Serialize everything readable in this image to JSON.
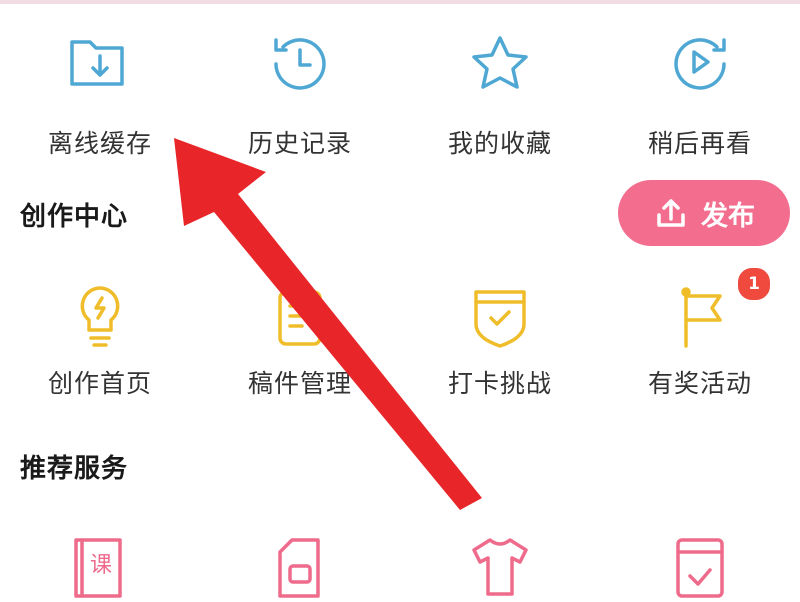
{
  "colors": {
    "blue_icon": "#4fa7d3",
    "yellow_icon": "#f0bd2a",
    "pink_icon": "#ee6b8c",
    "publish_bg": "#f36d8f",
    "badge_bg": "#f0493e",
    "annotation_arrow": "#e8262a"
  },
  "quick_actions": [
    {
      "label": "离线缓存",
      "icon": "download-folder-icon"
    },
    {
      "label": "历史记录",
      "icon": "history-clock-icon"
    },
    {
      "label": "我的收藏",
      "icon": "star-icon"
    },
    {
      "label": "稍后再看",
      "icon": "play-later-icon"
    }
  ],
  "creator_center": {
    "title": "创作中心",
    "publish_label": "发布",
    "items": [
      {
        "label": "创作首页",
        "icon": "lightbulb-icon"
      },
      {
        "label": "稿件管理",
        "icon": "manuscript-icon"
      },
      {
        "label": "打卡挑战",
        "icon": "shield-check-icon"
      },
      {
        "label": "有奖活动",
        "icon": "flag-icon",
        "badge": "1"
      }
    ]
  },
  "recommended_services": {
    "title": "推荐服务",
    "items": [
      {
        "icon": "course-book-icon",
        "icon_text": "课"
      },
      {
        "icon": "sim-card-icon"
      },
      {
        "icon": "tshirt-icon"
      },
      {
        "icon": "game-card-icon"
      }
    ]
  }
}
